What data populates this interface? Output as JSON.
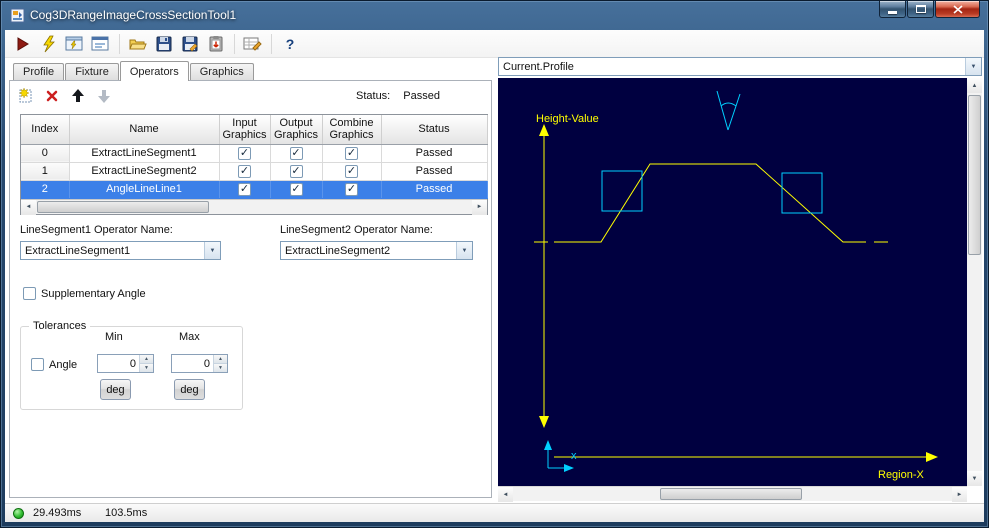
{
  "window": {
    "title": "Cog3DRangeImageCrossSectionTool1"
  },
  "toolbar": {
    "help_glyph": "?",
    "icons": [
      "run-icon",
      "run-electric-icon",
      "run-tool-group-icon",
      "show-tool-editor-icon",
      "open-icon",
      "save-icon",
      "save-as-icon",
      "paste-icon",
      "expression-editor-icon",
      "help-icon"
    ]
  },
  "tabs": [
    {
      "label": "Profile",
      "active": false
    },
    {
      "label": "Fixture",
      "active": false
    },
    {
      "label": "Operators",
      "active": true
    },
    {
      "label": "Graphics",
      "active": false
    }
  ],
  "operators": {
    "toolbar_icons": [
      "add-operator-icon",
      "delete-operator-icon",
      "move-up-icon",
      "move-down-icon"
    ],
    "status_label": "Status:",
    "status_value": "Passed",
    "table": {
      "columns": [
        "Index",
        "Name",
        "Input\nGraphics",
        "Output\nGraphics",
        "Combine\nGraphics",
        "Status"
      ],
      "rows": [
        {
          "index": "0",
          "name": "ExtractLineSegment1",
          "input": true,
          "output": true,
          "combine": true,
          "status": "Passed",
          "selected": false
        },
        {
          "index": "1",
          "name": "ExtractLineSegment2",
          "input": true,
          "output": true,
          "combine": true,
          "status": "Passed",
          "selected": false
        },
        {
          "index": "2",
          "name": "AngleLineLine1",
          "input": true,
          "output": true,
          "combine": true,
          "status": "Passed",
          "selected": true
        }
      ]
    },
    "line_segment1": {
      "label": "LineSegment1 Operator Name:",
      "value": "ExtractLineSegment1"
    },
    "line_segment2": {
      "label": "LineSegment2 Operator Name:",
      "value": "ExtractLineSegment2"
    },
    "supplementary_angle": {
      "label": "Supplementary Angle",
      "checked": false
    },
    "tolerances": {
      "group_label": "Tolerances",
      "min_label": "Min",
      "max_label": "Max",
      "angle": {
        "label": "Angle",
        "checked": false,
        "min": "0",
        "max": "0",
        "min_unit": "deg",
        "max_unit": "deg"
      }
    }
  },
  "graphics": {
    "selector": "Current.Profile",
    "labels": {
      "y_axis": "Height-Value",
      "x_axis": "Region-X",
      "origin": "x"
    },
    "colors": {
      "background": "#000040",
      "profile": "#ffff00",
      "highlight": "#00d0ff"
    }
  },
  "status_bar": {
    "times": [
      "29.493ms",
      "103.5ms"
    ]
  }
}
